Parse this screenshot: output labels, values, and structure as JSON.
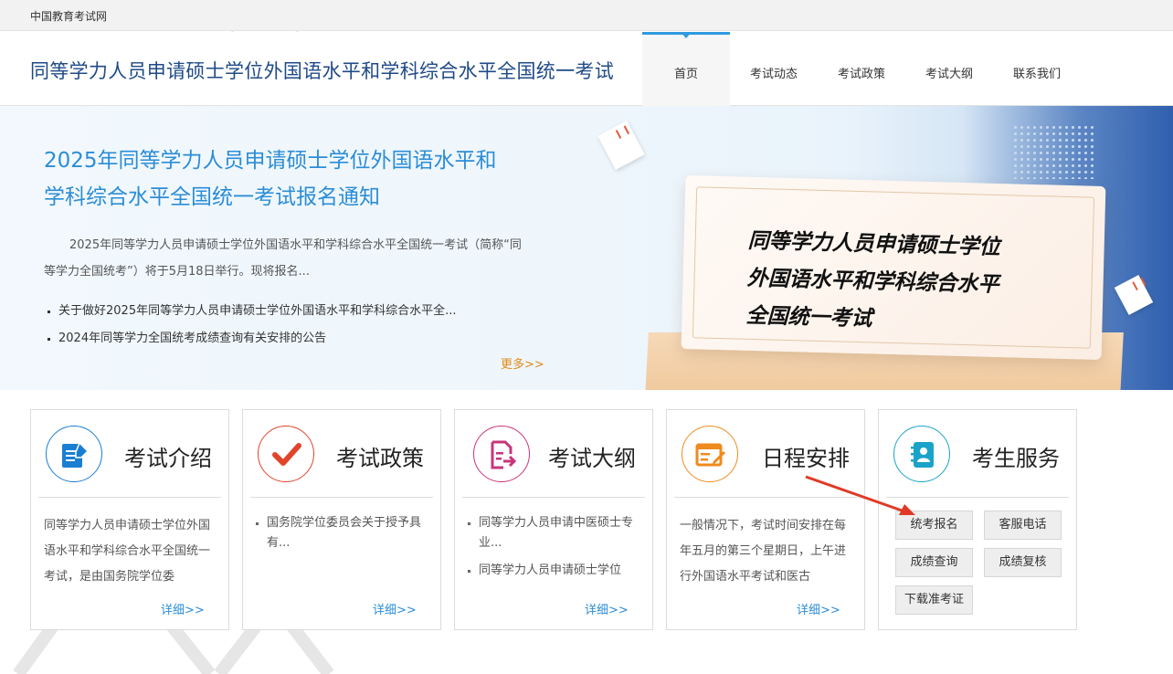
{
  "topbar": {
    "site_name": "中国教育考试网"
  },
  "header": {
    "title": "同等学力人员申请硕士学位外国语水平和学科综合水平全国统一考试",
    "nav": [
      {
        "label": "首页",
        "active": true
      },
      {
        "label": "考试动态",
        "active": false
      },
      {
        "label": "考试政策",
        "active": false
      },
      {
        "label": "考试大纲",
        "active": false
      },
      {
        "label": "联系我们",
        "active": false
      }
    ]
  },
  "banner": {
    "headline_line1": "2025年同等学力人员申请硕士学位外国语水平和",
    "headline_line2": "学科综合水平全国统一考试报名通知",
    "summary": "2025年同等学力人员申请硕士学位外国语水平和学科综合水平全国统一考试（简称“同等学力全国统考”）将于5月18日举行。现将报名...",
    "news": [
      "关于做好2025年同等学力人员申请硕士学位外国语水平和学科综合水平全...",
      "2024年同等学力全国统考成绩查询有关安排的公告"
    ],
    "more_label": "更多>>",
    "image_text_line1": "同等学力人员申请硕士学位",
    "image_text_line2": "外国语水平和学科综合水平",
    "image_text_line3": "全国统一考试"
  },
  "sections": {
    "intro": {
      "title": "考试介绍",
      "icon": "document-edit-icon",
      "color": "#1a7ed3",
      "text": "同等学力人员申请硕士学位外国语水平和学科综合水平全国统一考试，是由国务院学位委",
      "detail_label": "详细>>"
    },
    "policy": {
      "title": "考试政策",
      "icon": "checkmark-icon",
      "color": "#e0452b",
      "items": [
        "国务院学位委员会关于授予具有..."
      ],
      "detail_label": "详细>>"
    },
    "syllabus": {
      "title": "考试大纲",
      "icon": "file-export-icon",
      "color": "#c8357a",
      "items": [
        "同等学力人员申请中医硕士专业...",
        "同等学力人员申请硕士学位"
      ],
      "detail_label": "详细>>"
    },
    "schedule": {
      "title": "日程安排",
      "icon": "calendar-edit-icon",
      "color": "#f08a1d",
      "text": "一般情况下，考试时间安排在每年五月的第三个星期日，上午进行外国语水平考试和医古",
      "detail_label": "详细>>"
    },
    "service": {
      "title": "考生服务",
      "icon": "contact-book-icon",
      "color": "#1aa3c8",
      "buttons": [
        "统考报名",
        "客服电话",
        "成绩查询",
        "成绩复核",
        "下载准考证"
      ]
    }
  },
  "annotation": {
    "arrow_color": "#e03a26"
  }
}
